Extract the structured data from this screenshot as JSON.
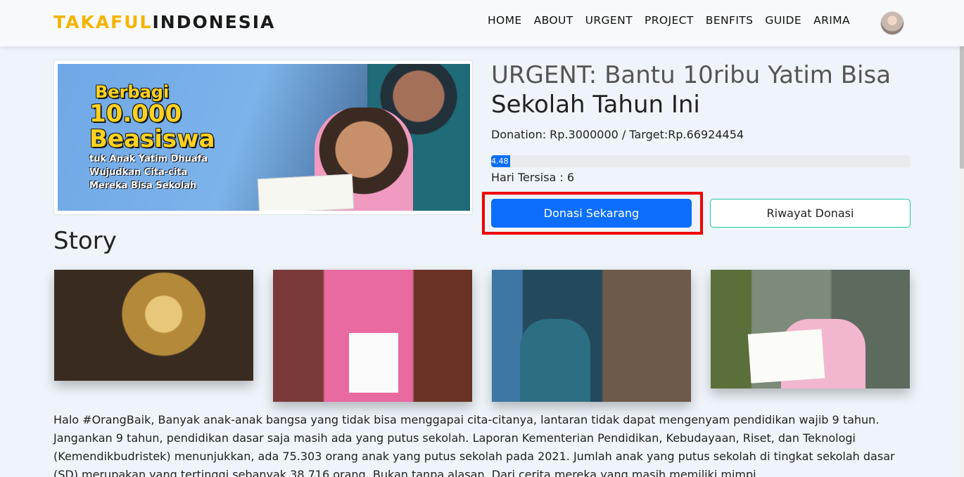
{
  "navbar": {
    "brand_part1": "TAKAFUL",
    "brand_part2": "INDONESIA",
    "links": [
      "HOME",
      "ABOUT",
      "URGENT",
      "PROJECT",
      "BENFITS",
      "GUIDE",
      "ARIMA"
    ]
  },
  "hero": {
    "line1": "Berbagi",
    "line2": "10.000",
    "line3": "Beasiswa",
    "line4": "tuk Anak Yatim Dhuafa",
    "line5": "Wujudkan Cita-cita",
    "line6": "Mereka Bisa Sekolah"
  },
  "campaign": {
    "title_part1": "URGENT: Bantu 10ribu Yatim Bisa",
    "title_part2": "Sekolah Tahun Ini",
    "donation_text": "Donation: Rp.3000000 / Target:Rp.66924454",
    "progress_percent": 4.48,
    "progress_label": "4.48",
    "days_left_text": "Hari Tersisa : 6",
    "donate_button": "Donasi Sekarang",
    "history_button": "Riwayat Donasi"
  },
  "story": {
    "heading": "Story",
    "text": "Halo #OrangBaik, Banyak anak-anak bangsa yang tidak bisa menggapai cita-citanya, lantaran tidak dapat mengenyam pendidikan wajib 9 tahun. Jangankan 9 tahun, pendidikan dasar saja masih ada yang putus sekolah. Laporan Kementerian Pendidikan, Kebudayaan, Riset, dan Teknologi (Kemendikbudristek) menunjukkan, ada 75.303 orang anak yang putus sekolah pada 2021. Jumlah anak yang putus sekolah di tingkat sekolah dasar (SD) merupakan yang tertinggi sebanyak 38.716 orang. Bukan tanpa alasan. Dari cerita mereka yang masih memiliki mimpi,"
  },
  "colors": {
    "brand_yellow": "#f5b400",
    "primary_blue": "#0d6efd",
    "teal_border": "#20c997",
    "highlight_red": "#ee0000"
  }
}
